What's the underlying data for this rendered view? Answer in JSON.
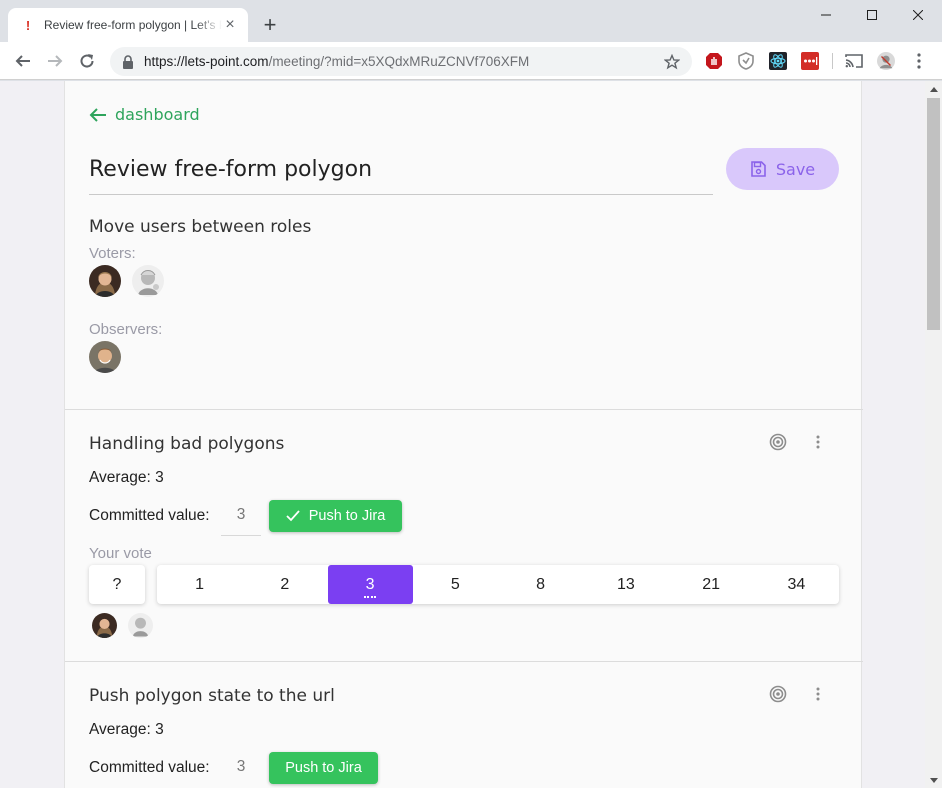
{
  "browser": {
    "tab_title": "Review free-form polygon | Let's Point",
    "tab_favicon": "!",
    "url_host": "https://lets-point.com",
    "url_path": "/meeting/?mid=x5XQdxMRuZCNVf706XFM",
    "new_tab_label": "+",
    "close_tab_label": "×"
  },
  "header": {
    "back_label": "dashboard",
    "meeting_title": "Review free-form polygon",
    "save_label": "Save"
  },
  "roles": {
    "heading": "Move users between roles",
    "voters_label": "Voters:",
    "observers_label": "Observers:"
  },
  "stories": [
    {
      "title": "Handling bad polygons",
      "average": "Average: 3",
      "committed_label": "Committed value:",
      "committed_value": "3",
      "push_label": "Push to Jira",
      "your_vote_label": "Your vote",
      "unknown_option": "?",
      "options": [
        "1",
        "2",
        "3",
        "5",
        "8",
        "13",
        "21",
        "34"
      ],
      "selected": "3"
    },
    {
      "title": "Push polygon state to the url",
      "average": "Average: 3",
      "committed_label": "Committed value:",
      "committed_value": "3",
      "push_label": "Push to Jira"
    }
  ],
  "colors": {
    "accent_green": "#2ea45c",
    "jira_green": "#35c35d",
    "vote_purple": "#7b3ff2",
    "save_bg": "#d9c8fb"
  },
  "icons": {
    "back": "arrow-left-icon",
    "save": "floppy-disk-icon",
    "story_target": "target-icon",
    "story_menu": "more-vert-icon",
    "push_check": "check-icon"
  }
}
